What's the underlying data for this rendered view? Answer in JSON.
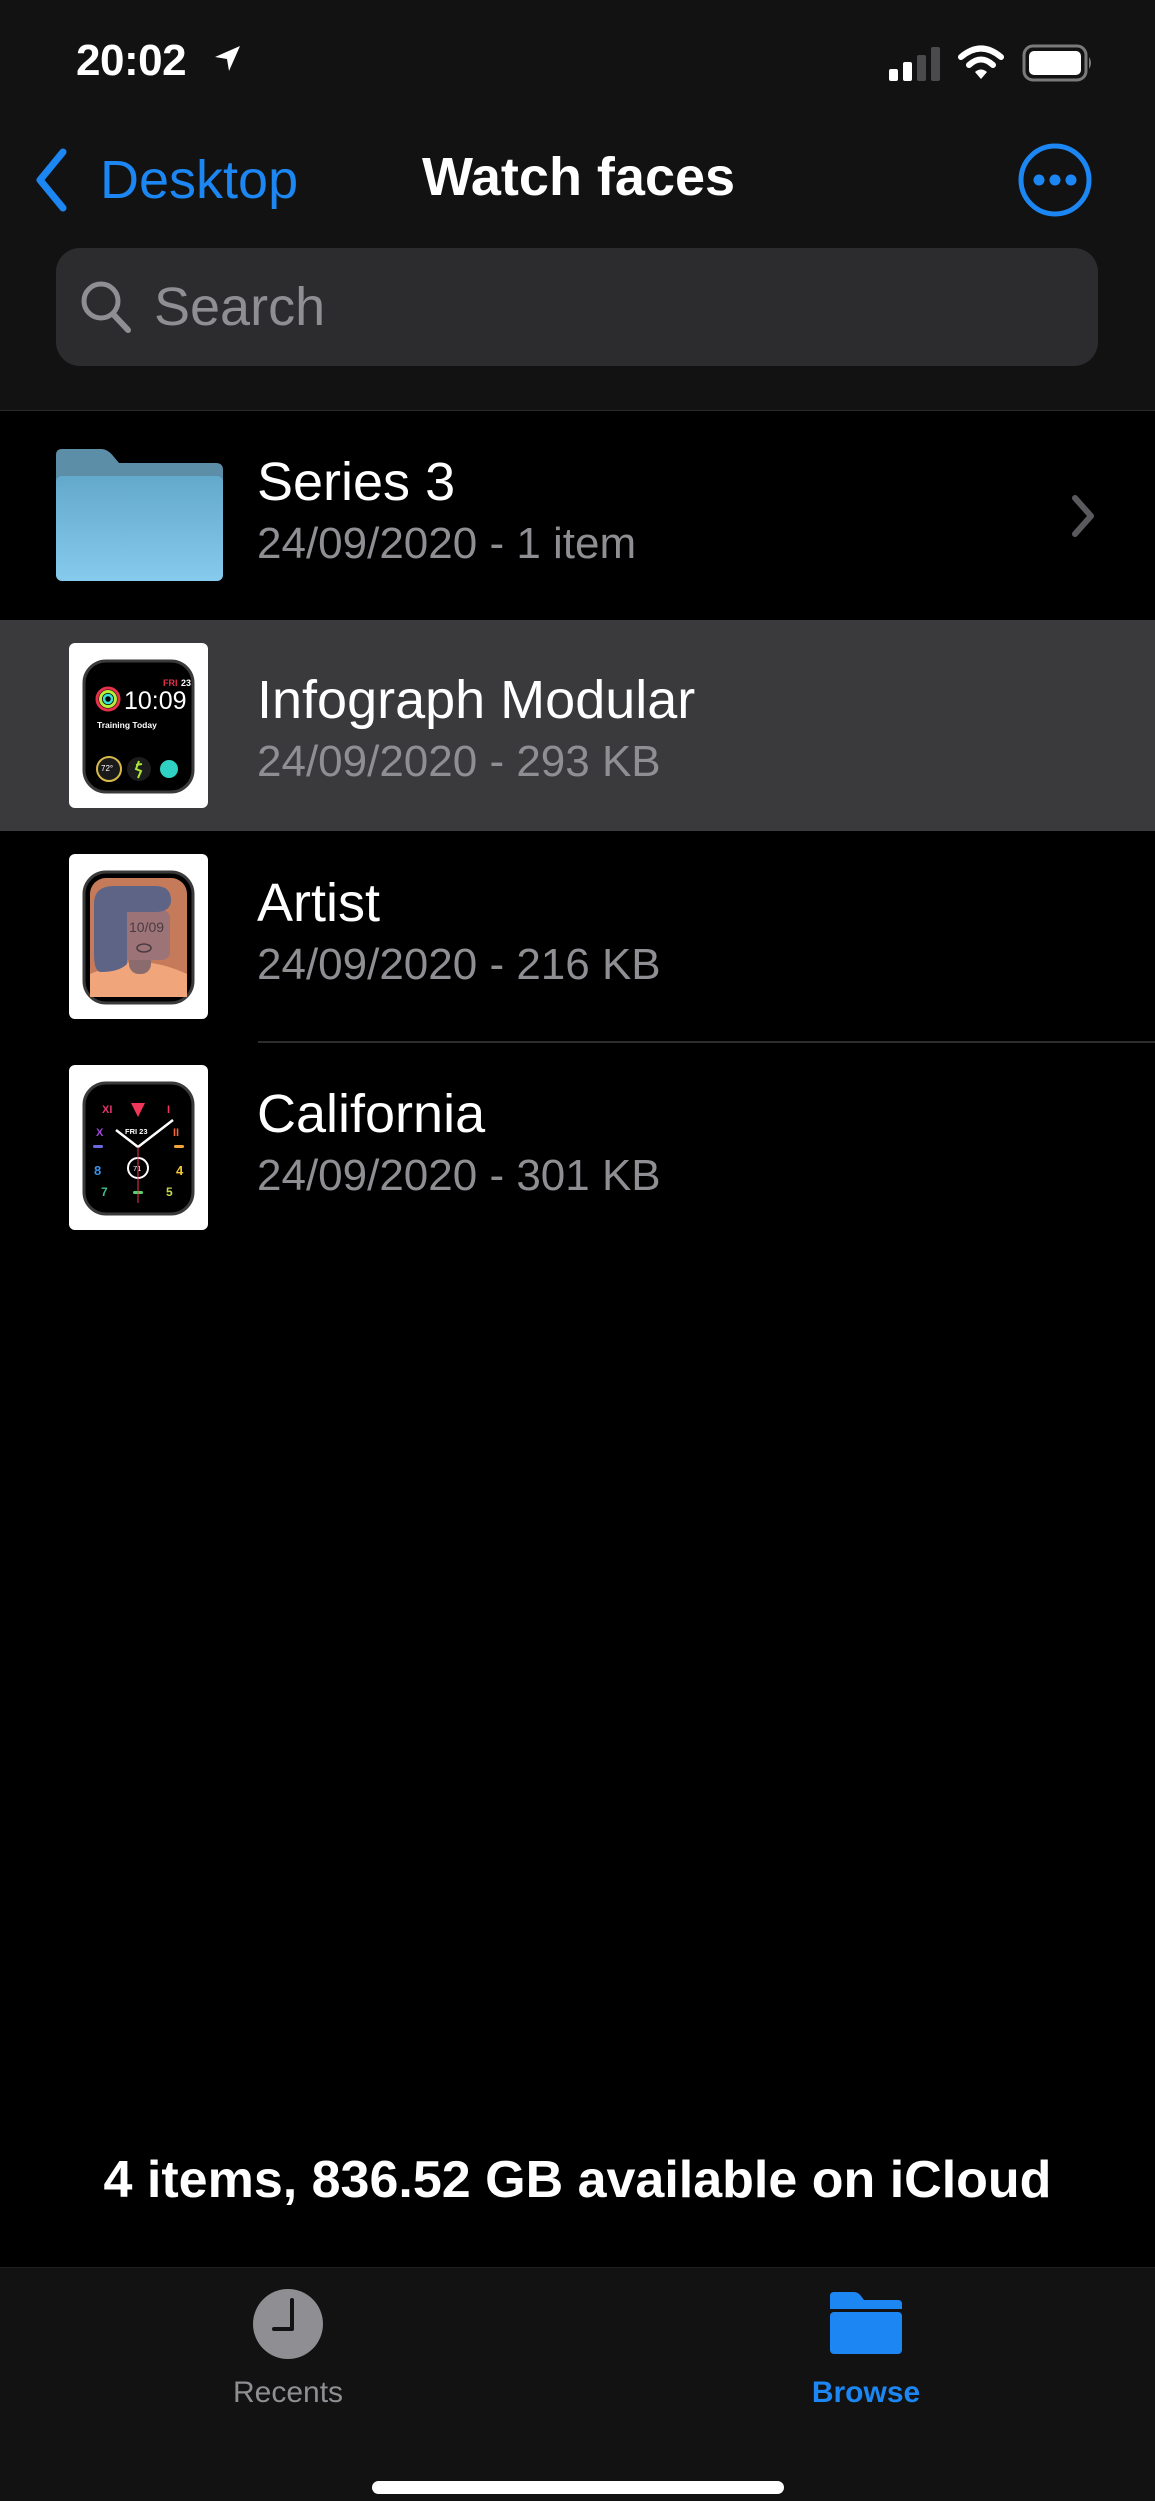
{
  "status_bar": {
    "time": "20:02",
    "location_icon": "location-arrow-icon",
    "signal_bars_filled": 2,
    "signal_bars_total": 4,
    "wifi_icon": "wifi-icon",
    "battery_level_percent": 95
  },
  "nav": {
    "back_label": "Desktop",
    "title": "Watch faces",
    "more_icon": "ellipsis-circle-icon"
  },
  "search": {
    "placeholder": "Search",
    "value": ""
  },
  "files": [
    {
      "name": "Series 3",
      "meta": "24/09/2020 - 1 item",
      "type": "folder",
      "selected": false
    },
    {
      "name": "Infograph Modular",
      "meta": "24/09/2020 - 293 KB",
      "type": "watchface",
      "selected": true,
      "thumb": {
        "day": "FRI",
        "date": "23",
        "time": "10:09",
        "label": "Training Today",
        "temp": "72°"
      }
    },
    {
      "name": "Artist",
      "meta": "24/09/2020 - 216 KB",
      "type": "watchface",
      "selected": false,
      "thumb": {
        "time": "10/09"
      }
    },
    {
      "name": "California",
      "meta": "24/09/2020 - 301 KB",
      "type": "watchface",
      "selected": false,
      "thumb": {
        "day_date": "FRI 23",
        "complication": "71",
        "numerals": [
          "XI",
          "I",
          "X",
          "II",
          "8",
          "4",
          "7",
          "5"
        ]
      }
    }
  ],
  "footer": {
    "summary": "4 items, 836.52 GB available on iCloud"
  },
  "tabbar": {
    "tabs": [
      {
        "label": "Recents",
        "icon": "clock-icon",
        "active": false
      },
      {
        "label": "Browse",
        "icon": "folder-icon",
        "active": true
      }
    ]
  },
  "colors": {
    "accent": "#1c86f2",
    "secondary_text": "#8e8e93",
    "selected_row": "#3a3a3c",
    "header_bg": "#121212"
  }
}
